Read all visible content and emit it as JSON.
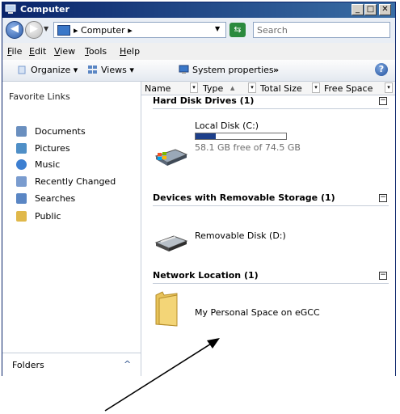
{
  "window": {
    "title": "Computer",
    "min_btn": "_",
    "max_btn": "□",
    "close_btn": "✕"
  },
  "nav": {
    "back_glyph": "◀",
    "forward_glyph": "▶",
    "recent_glyph": "▼"
  },
  "address": {
    "path": "▸ Computer ▸",
    "dropdown_glyph": "▼",
    "refresh_glyph": "⇆"
  },
  "search": {
    "placeholder": "Search"
  },
  "menu": {
    "file": {
      "hotkey": "F",
      "rest": "ile"
    },
    "edit": {
      "hotkey": "E",
      "rest": "dit"
    },
    "view": {
      "hotkey": "V",
      "rest": "iew"
    },
    "tools": {
      "hotkey": "T",
      "rest": "ools"
    },
    "help": {
      "hotkey": "H",
      "rest": "elp"
    }
  },
  "toolbar": {
    "organize": "Organize ▾",
    "views": "Views ▾",
    "system_properties": "System properties",
    "more": "»",
    "help": "?"
  },
  "sidebar": {
    "heading": "Favorite Links",
    "items": [
      {
        "label": "Documents",
        "icon": "documents-icon",
        "color": "#6a8fbf"
      },
      {
        "label": "Pictures",
        "icon": "pictures-icon",
        "color": "#4f8fc7"
      },
      {
        "label": "Music",
        "icon": "music-icon",
        "color": "#3d7fd1"
      },
      {
        "label": "Recently Changed",
        "icon": "recently-changed-icon",
        "color": "#7a9ccf"
      },
      {
        "label": "Searches",
        "icon": "searches-icon",
        "color": "#5a86c4"
      },
      {
        "label": "Public",
        "icon": "public-folder-icon",
        "color": "#e0b84a"
      }
    ],
    "folders_label": "Folders",
    "folders_chevron": "^"
  },
  "columns": {
    "name": "Name",
    "type": "Type",
    "type_sort": "▲",
    "total_size": "Total Size",
    "free_space": "Free Space",
    "menu_glyph": "▾"
  },
  "groups": {
    "hdd": {
      "title": "Hard Disk Drives (1)",
      "collapse": "−",
      "item": {
        "name": "Local Disk (C:)",
        "detail": "58.1 GB free of 74.5 GB",
        "used_fraction": 0.22
      }
    },
    "removable": {
      "title": "Devices with Removable Storage (1)",
      "collapse": "−",
      "item": {
        "name": "Removable Disk (D:)"
      }
    },
    "network": {
      "title": "Network Location (1)",
      "collapse": "−",
      "item": {
        "name": "My Personal Space on eGCC"
      }
    }
  },
  "colors": {
    "title_bar": "#0a246a",
    "capacity_fill": "#1d3f8a",
    "folder": "#e8c35a"
  }
}
